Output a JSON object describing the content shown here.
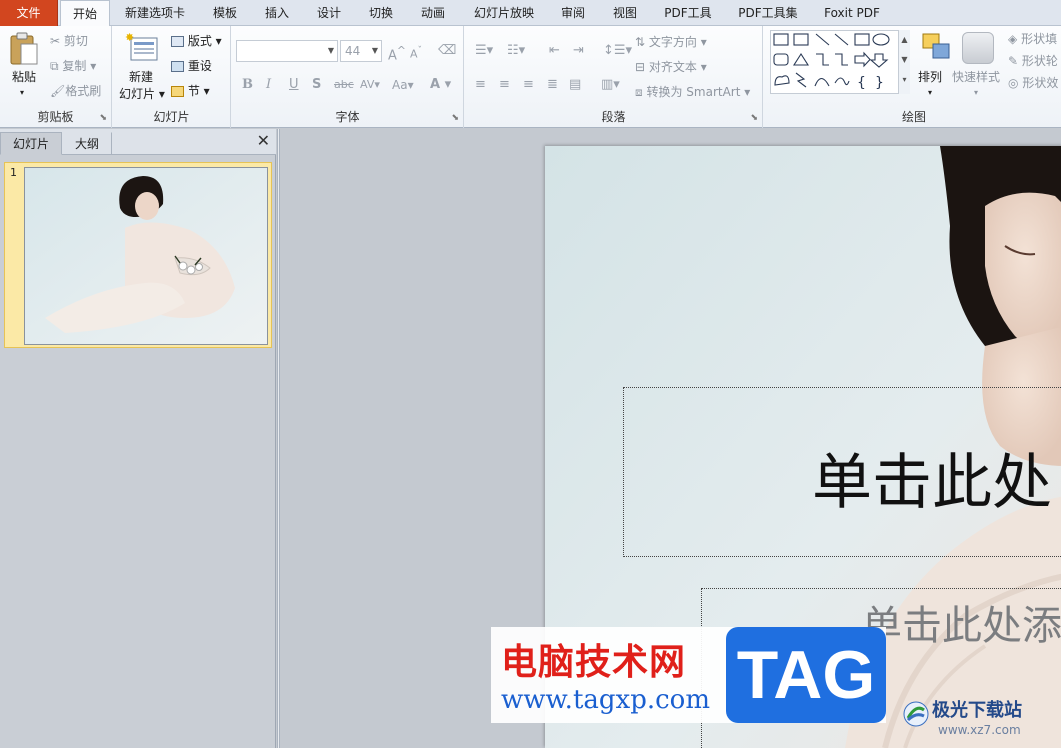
{
  "tabs": [
    {
      "label": "文件",
      "type": "file"
    },
    {
      "label": "开始",
      "active": true
    },
    {
      "label": "新建选项卡"
    },
    {
      "label": "模板"
    },
    {
      "label": "插入"
    },
    {
      "label": "设计"
    },
    {
      "label": "切换"
    },
    {
      "label": "动画"
    },
    {
      "label": "幻灯片放映"
    },
    {
      "label": "审阅"
    },
    {
      "label": "视图"
    },
    {
      "label": "PDF工具"
    },
    {
      "label": "PDF工具集"
    },
    {
      "label": "Foxit PDF"
    }
  ],
  "ribbon": {
    "clipboard": {
      "label": "剪贴板",
      "paste": "粘贴",
      "cut": "剪切",
      "copy": "复制",
      "format_painter": "格式刷"
    },
    "slides": {
      "label": "幻灯片",
      "new_line1": "新建",
      "new_line2": "幻灯片",
      "layout": "版式",
      "reset": "重设",
      "section": "节"
    },
    "font": {
      "label": "字体",
      "font_name": "",
      "font_size": "44",
      "bold": "B",
      "italic": "I",
      "underline": "U",
      "shadow": "S",
      "strike": "abc",
      "spacing": "AV",
      "case": "Aa",
      "color": "A"
    },
    "paragraph": {
      "label": "段落",
      "text_direction": "文字方向",
      "align_text": "对齐文本",
      "smartart": "转换为 SmartArt"
    },
    "drawing": {
      "label": "绘图",
      "arrange": "排列",
      "quick_styles": "快速样式",
      "fill": "形状填",
      "outline": "形状轮",
      "effect": "形状效"
    }
  },
  "left_pane": {
    "tab_slides": "幻灯片",
    "tab_outline": "大纲",
    "close": "✕",
    "slide_number": "1"
  },
  "slide": {
    "title_placeholder": "单击此处",
    "subtitle_placeholder": "单击此处添"
  },
  "watermarks": {
    "site_cn": "电脑技术网",
    "site_url": "www.tagxp.com",
    "tag": "TAG",
    "site2_cn": "极光下载站",
    "site2_url": "www.xz7.com"
  },
  "colors": {
    "file_tab": "#d2461f",
    "ribbon_bg": "#eef2f7",
    "thumb_selected": "#fbe9a6",
    "workspace": "#c4c9d0",
    "watermark_red": "#e0201a",
    "watermark_blue": "#1f6fe0"
  }
}
